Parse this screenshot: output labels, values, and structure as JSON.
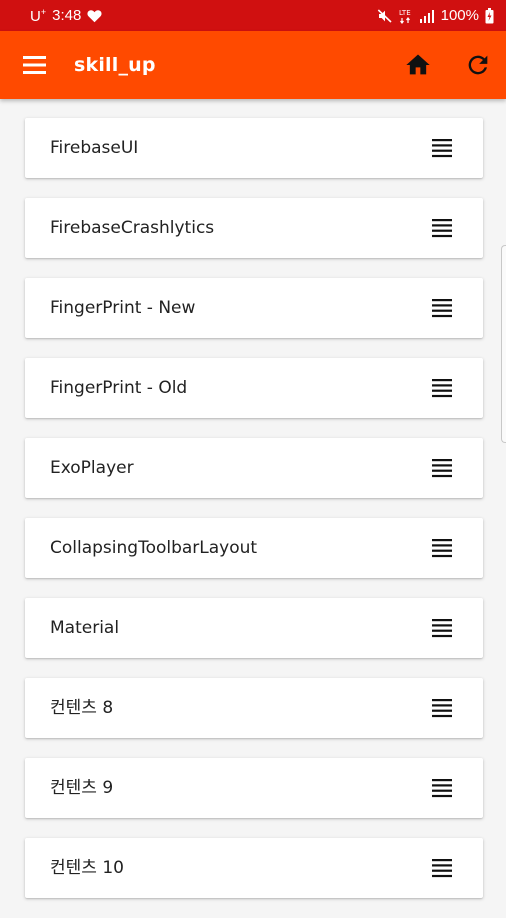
{
  "status_bar": {
    "carrier": "U",
    "carrier_sup": "+",
    "time": "3:48",
    "battery": "100%",
    "icons": [
      "heart-icon",
      "mute-icon",
      "lte-icon",
      "signal-icon",
      "battery-icon"
    ]
  },
  "app_bar": {
    "title": "skill_up",
    "icons": [
      "menu-icon",
      "home-icon",
      "refresh-icon"
    ],
    "color": "#ff4a00"
  },
  "status_color": "#d01010",
  "items": [
    {
      "label": "FirebaseUI"
    },
    {
      "label": "FirebaseCrashlytics"
    },
    {
      "label": "FingerPrint - New"
    },
    {
      "label": "FingerPrint - Old"
    },
    {
      "label": "ExoPlayer"
    },
    {
      "label": "CollapsingToolbarLayout"
    },
    {
      "label": "Material"
    },
    {
      "label": "컨텐츠 8"
    },
    {
      "label": "컨텐츠 9"
    },
    {
      "label": "컨텐츠 10"
    }
  ]
}
